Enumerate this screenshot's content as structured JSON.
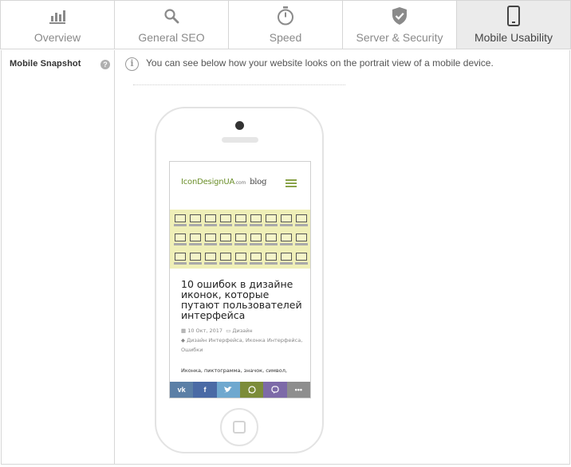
{
  "tabs": [
    {
      "label": "Overview",
      "icon": "bar-chart-icon",
      "active": false
    },
    {
      "label": "General SEO",
      "icon": "search-icon",
      "active": false
    },
    {
      "label": "Speed",
      "icon": "stopwatch-icon",
      "active": false
    },
    {
      "label": "Server & Security",
      "icon": "shield-check-icon",
      "active": false
    },
    {
      "label": "Mobile Usability",
      "icon": "mobile-phone-icon",
      "active": true
    }
  ],
  "sidebar": {
    "label": "Mobile Snapshot",
    "help_icon": "question-icon"
  },
  "main": {
    "info_text": "You can see below how your website looks on the portrait view of a mobile device.",
    "info_icon": "info-icon"
  },
  "snapshot": {
    "logo_text": "IconDesignUA",
    "logo_domain": ".com",
    "logo_blog": "blog",
    "post_title": "10 ошибок в дизайне иконок, которые путают пользователей интерфейса",
    "meta_date": "10 Окт, 2017",
    "meta_category": "Дизайн",
    "meta_tags": "Дизайн Интерфейса, Иконка Интерфейса, Ошибки",
    "tags_line": "Иконка, пиктограмма, значок, символ,",
    "share_buttons": [
      {
        "label": "vk",
        "icon": "vk-icon",
        "color": "#5b7fa6"
      },
      {
        "label": "f",
        "icon": "facebook-icon",
        "color": "#4a6aa5"
      },
      {
        "label": "",
        "icon": "twitter-icon",
        "color": "#6fa8cf"
      },
      {
        "label": "",
        "icon": "whatsapp-icon",
        "color": "#7c8c3a"
      },
      {
        "label": "",
        "icon": "viber-icon",
        "color": "#7d6aa8"
      },
      {
        "label": "•••",
        "icon": "more-icon",
        "color": "#8e8e8e"
      }
    ]
  },
  "colors": {
    "active_tab": "#ebebeb",
    "border": "#d6d6d6",
    "hero_bg": "#efefb7"
  }
}
